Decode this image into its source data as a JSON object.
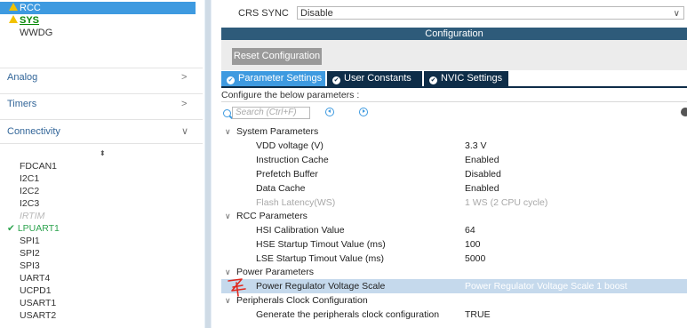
{
  "left_panel": {
    "system_core": [
      {
        "label": "RCC",
        "warn": true,
        "selected": true
      },
      {
        "label": "SYS",
        "warn": true,
        "selected": false
      },
      {
        "label": "WWDG",
        "warn": false,
        "selected": false
      }
    ],
    "categories": [
      {
        "label": "Analog",
        "chevron": ">"
      },
      {
        "label": "Timers",
        "chevron": ">"
      },
      {
        "label": "Connectivity",
        "chevron": "∨"
      }
    ],
    "sort_icon": "⬍",
    "peripherals": [
      {
        "label": "FDCAN1",
        "state": "normal"
      },
      {
        "label": "I2C1",
        "state": "normal"
      },
      {
        "label": "I2C2",
        "state": "normal"
      },
      {
        "label": "I2C3",
        "state": "normal"
      },
      {
        "label": "IRTIM",
        "state": "disabled"
      },
      {
        "label": "LPUART1",
        "state": "configured"
      },
      {
        "label": "SPI1",
        "state": "normal"
      },
      {
        "label": "SPI2",
        "state": "normal"
      },
      {
        "label": "SPI3",
        "state": "normal"
      },
      {
        "label": "UART4",
        "state": "normal"
      },
      {
        "label": "UCPD1",
        "state": "normal"
      },
      {
        "label": "USART1",
        "state": "normal"
      },
      {
        "label": "USART2",
        "state": "normal"
      }
    ],
    "checkmark": "✔"
  },
  "crs_sync": {
    "label": "CRS SYNC",
    "value": "Disable",
    "chevron": "∨"
  },
  "configuration": {
    "header": "Configuration",
    "reset_button": "Reset Configuration",
    "tabs": [
      {
        "label": "Parameter Settings",
        "active": true
      },
      {
        "label": "User Constants",
        "active": false
      },
      {
        "label": "NVIC Settings",
        "active": false
      }
    ],
    "prompt": "Configure the below parameters :",
    "search_placeholder": "Search (Ctrl+F)"
  },
  "parameter_groups": [
    {
      "name": "System Parameters",
      "params": [
        {
          "name": "VDD voltage (V)",
          "value": "3.3 V",
          "disabled": false
        },
        {
          "name": "Instruction Cache",
          "value": "Enabled",
          "disabled": false
        },
        {
          "name": "Prefetch Buffer",
          "value": "Disabled",
          "disabled": false
        },
        {
          "name": "Data Cache",
          "value": "Enabled",
          "disabled": false
        },
        {
          "name": "Flash Latency(WS)",
          "value": "1 WS (2 CPU cycle)",
          "disabled": true
        }
      ]
    },
    {
      "name": "RCC Parameters",
      "params": [
        {
          "name": "HSI Calibration Value",
          "value": "64",
          "disabled": false
        },
        {
          "name": "HSE Startup Timout Value (ms)",
          "value": "100",
          "disabled": false
        },
        {
          "name": "LSE Startup Timout Value (ms)",
          "value": "5000",
          "disabled": false
        }
      ]
    },
    {
      "name": "Power Parameters",
      "params": [
        {
          "name": "Power Regulator Voltage Scale",
          "value": "Power Regulator Voltage Scale 1 boost",
          "disabled": false,
          "highlighted": true
        }
      ]
    },
    {
      "name": "Peripherals Clock Configuration",
      "params": [
        {
          "name": "Generate the peripherals clock configuration",
          "value": "TRUE",
          "disabled": false
        }
      ]
    }
  ],
  "colors": {
    "selection": "#3e9ae0",
    "header_bar": "#2e5b7a",
    "tab_dark": "#0e2d48",
    "warning": "#f2c200",
    "configured": "#2ea44f",
    "annotation": "#e0281e"
  }
}
